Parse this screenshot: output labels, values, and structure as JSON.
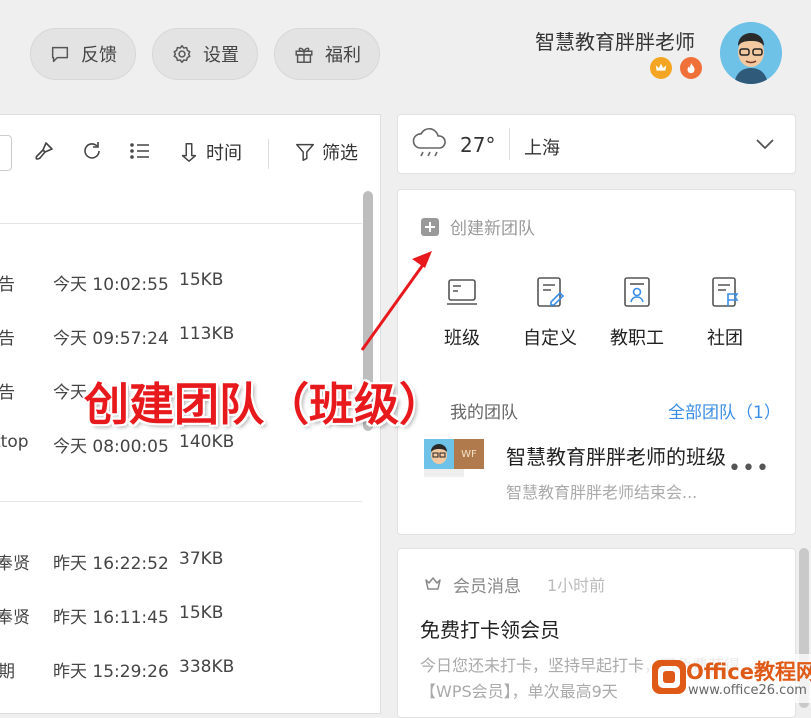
{
  "header": {
    "feedback_label": "反馈",
    "settings_label": "设置",
    "welfare_label": "福利",
    "username": "智慧教育胖胖老师"
  },
  "toolbar": {
    "time_label": "时间",
    "filter_label": "筛选"
  },
  "files": [
    {
      "name": "告",
      "time": "今天 10:02:55",
      "size": "15KB"
    },
    {
      "name": "告",
      "time": "今天 09:57:24",
      "size": "113KB"
    },
    {
      "name": "告",
      "time": "今天",
      "size": ""
    },
    {
      "name": "ttop",
      "time": "今天 08:00:05",
      "size": "140KB"
    },
    {
      "name": "奉贤",
      "time": "昨天 16:22:52",
      "size": "37KB"
    },
    {
      "name": "奉贤",
      "time": "昨天 16:11:45",
      "size": "15KB"
    },
    {
      "name": "期",
      "time": "昨天 15:29:26",
      "size": "338KB"
    }
  ],
  "weather": {
    "temperature": "27°",
    "city": "上海"
  },
  "team": {
    "create_label": "创建新团队",
    "types": [
      "班级",
      "自定义",
      "教职工",
      "社团"
    ],
    "my_team_label": "我的团队",
    "all_team_label": "全部团队（1）",
    "team_name": "智慧教育胖胖老师的班级",
    "team_sub": "智慧教育胖胖老师结束会...",
    "avatar_tag": "WF"
  },
  "message": {
    "label": "会员消息",
    "time": "1小时前",
    "title": "免费打卡领会员",
    "body": "今日您还未打卡，坚持早起打卡，可免费获得【WPS会员】，单次最高9天"
  },
  "annotation": {
    "text": "创建团队（班级）"
  },
  "watermark": {
    "name": "Office教程网",
    "url": "www.office26.com"
  },
  "colors": {
    "accent": "#3a8ee6",
    "annotation": "#e8191c",
    "badge_crown": "#f4a623",
    "badge_fire": "#f0703a"
  }
}
